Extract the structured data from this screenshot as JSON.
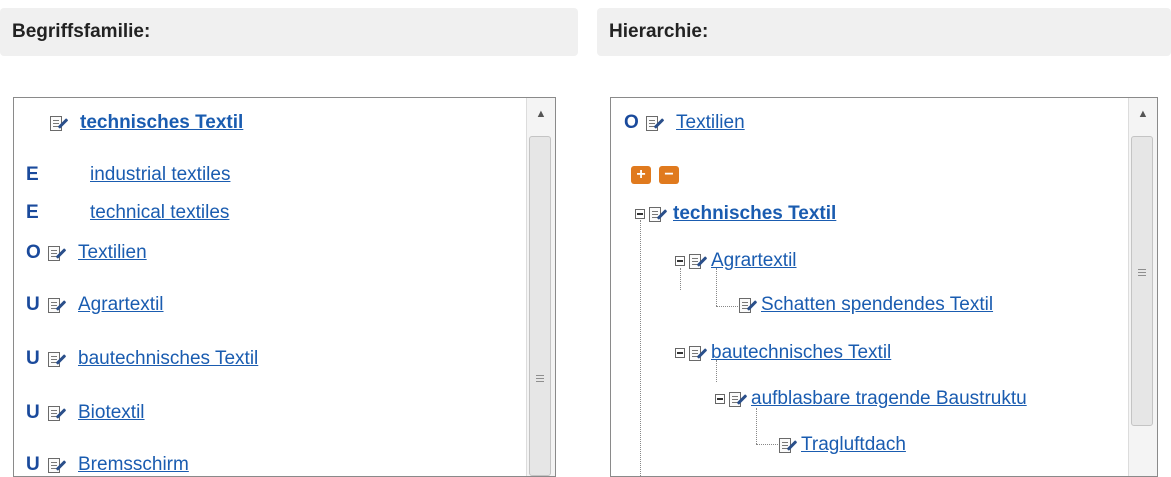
{
  "left": {
    "header": "Begriffsfamilie:",
    "items": [
      {
        "code": "",
        "label": "technisches Textil"
      },
      {
        "code": "E",
        "label": "industrial textiles"
      },
      {
        "code": "E",
        "label": "technical textiles"
      },
      {
        "code": "O",
        "label": "Textilien"
      },
      {
        "code": "U",
        "label": "Agrartextil"
      },
      {
        "code": "U",
        "label": "bautechnisches Textil"
      },
      {
        "code": "U",
        "label": "Biotextil"
      },
      {
        "code": "U",
        "label": "Bremsschirm"
      }
    ]
  },
  "right": {
    "header": "Hierarchie:",
    "root": {
      "code": "O",
      "label": "Textilien"
    },
    "controls": {
      "expand": "+",
      "collapse": "−"
    },
    "tree": [
      {
        "label": "technisches Textil"
      },
      {
        "label": "Agrartextil"
      },
      {
        "label": "Schatten spendendes Textil"
      },
      {
        "label": "bautechnisches Textil"
      },
      {
        "label": "aufblasbare tragende Baustruktu"
      },
      {
        "label": "Tragluftdach"
      }
    ]
  },
  "scrollbar": {
    "up_arrow": "▲"
  },
  "icons": [
    "edit-icon",
    "expand-icon",
    "collapse-icon",
    "tree-collapse-icon",
    "scroll-up-icon",
    "scroll-grip-icon"
  ]
}
